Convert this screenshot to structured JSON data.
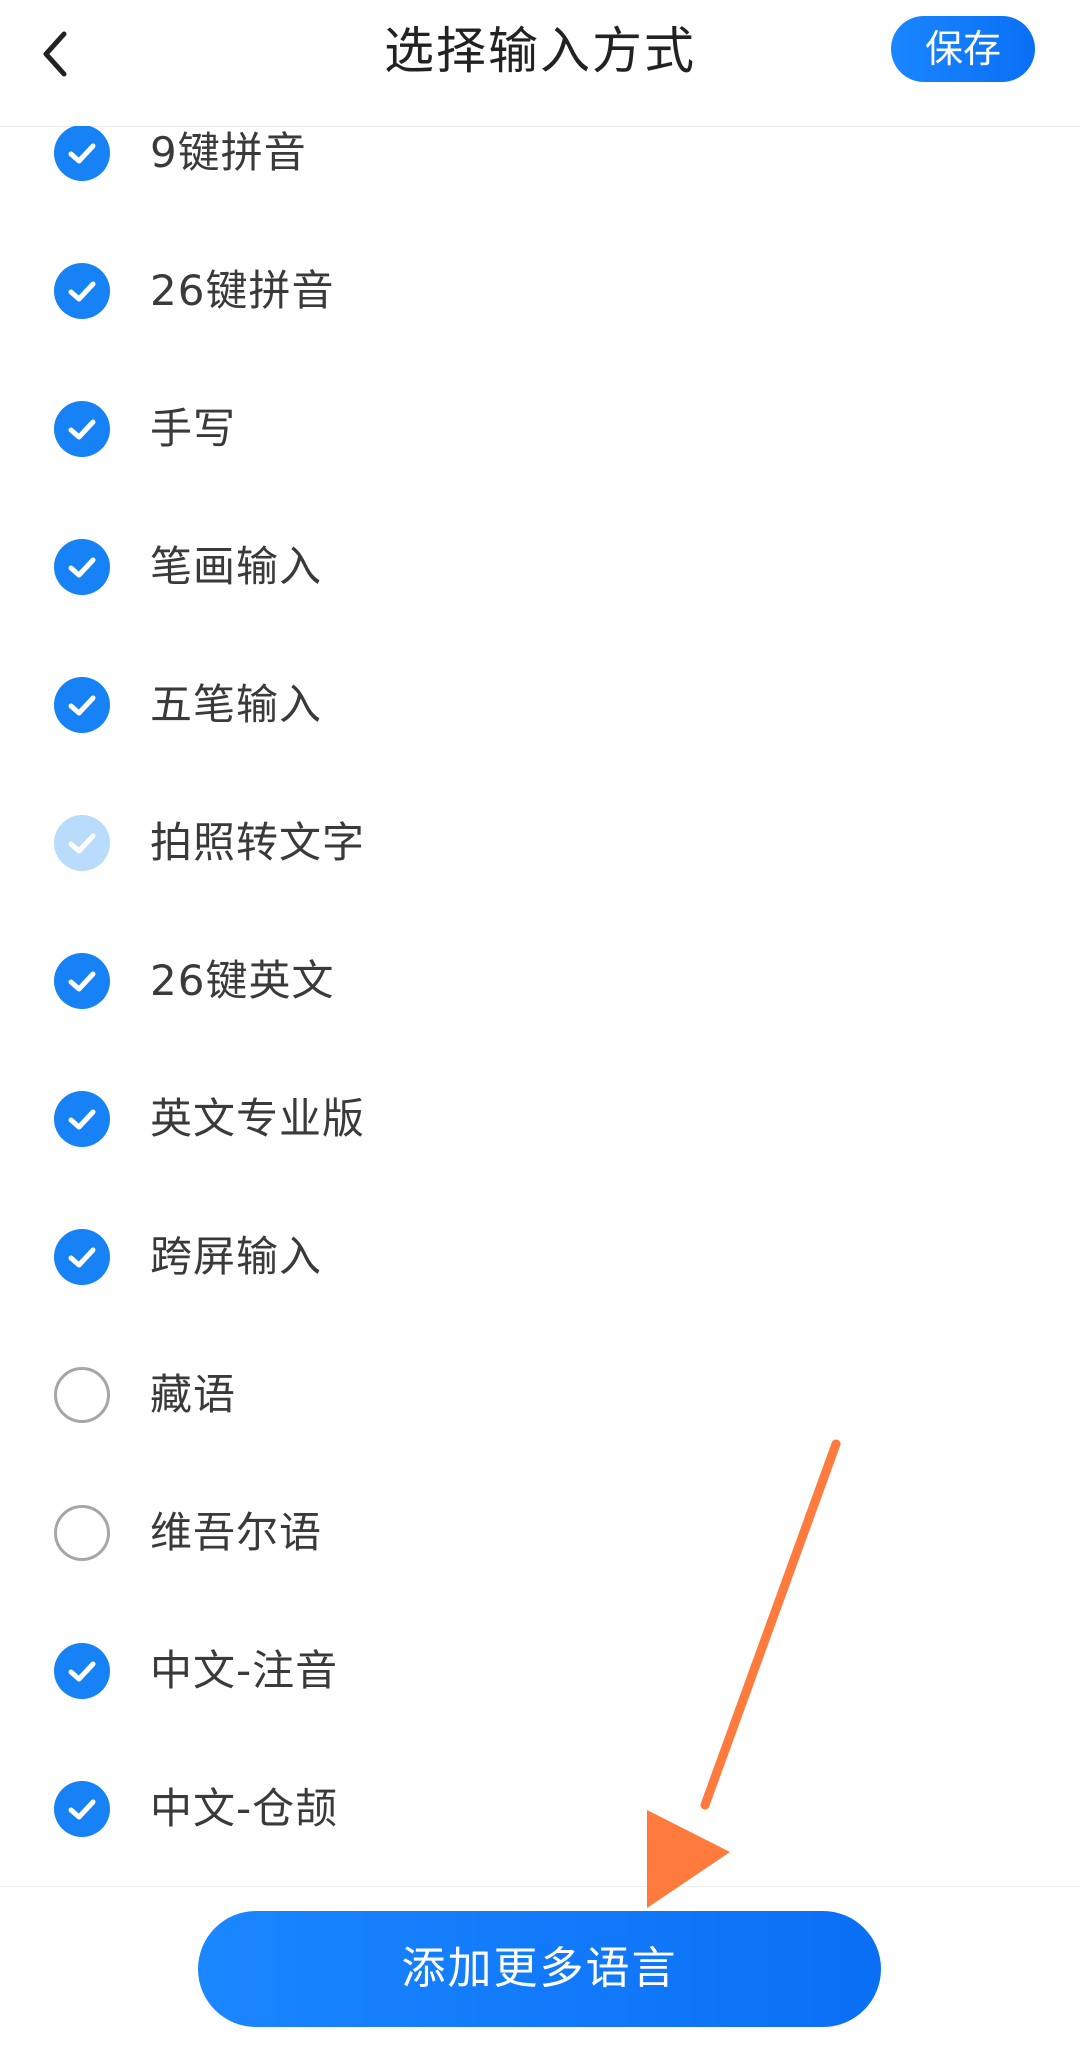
{
  "header": {
    "title": "选择输入方式",
    "save_label": "保存"
  },
  "items": [
    {
      "label": "9键拼音",
      "state": "checked"
    },
    {
      "label": "26键拼音",
      "state": "checked"
    },
    {
      "label": "手写",
      "state": "checked"
    },
    {
      "label": "笔画输入",
      "state": "checked"
    },
    {
      "label": "五笔输入",
      "state": "checked"
    },
    {
      "label": "拍照转文字",
      "state": "disabled-checked"
    },
    {
      "label": "26键英文",
      "state": "checked"
    },
    {
      "label": "英文专业版",
      "state": "checked"
    },
    {
      "label": "跨屏输入",
      "state": "checked"
    },
    {
      "label": "藏语",
      "state": "unchecked"
    },
    {
      "label": "维吾尔语",
      "state": "unchecked"
    },
    {
      "label": "中文-注音",
      "state": "checked"
    },
    {
      "label": "中文-仓颉",
      "state": "checked"
    }
  ],
  "footer": {
    "add_more_label": "添加更多语言"
  },
  "colors": {
    "accent": "#1682f6",
    "disabled_check": "#b9dbfc",
    "annotation_arrow": "#ff7a3d"
  },
  "icons": {
    "back": "chevron-left-icon",
    "check": "checkmark-icon"
  }
}
